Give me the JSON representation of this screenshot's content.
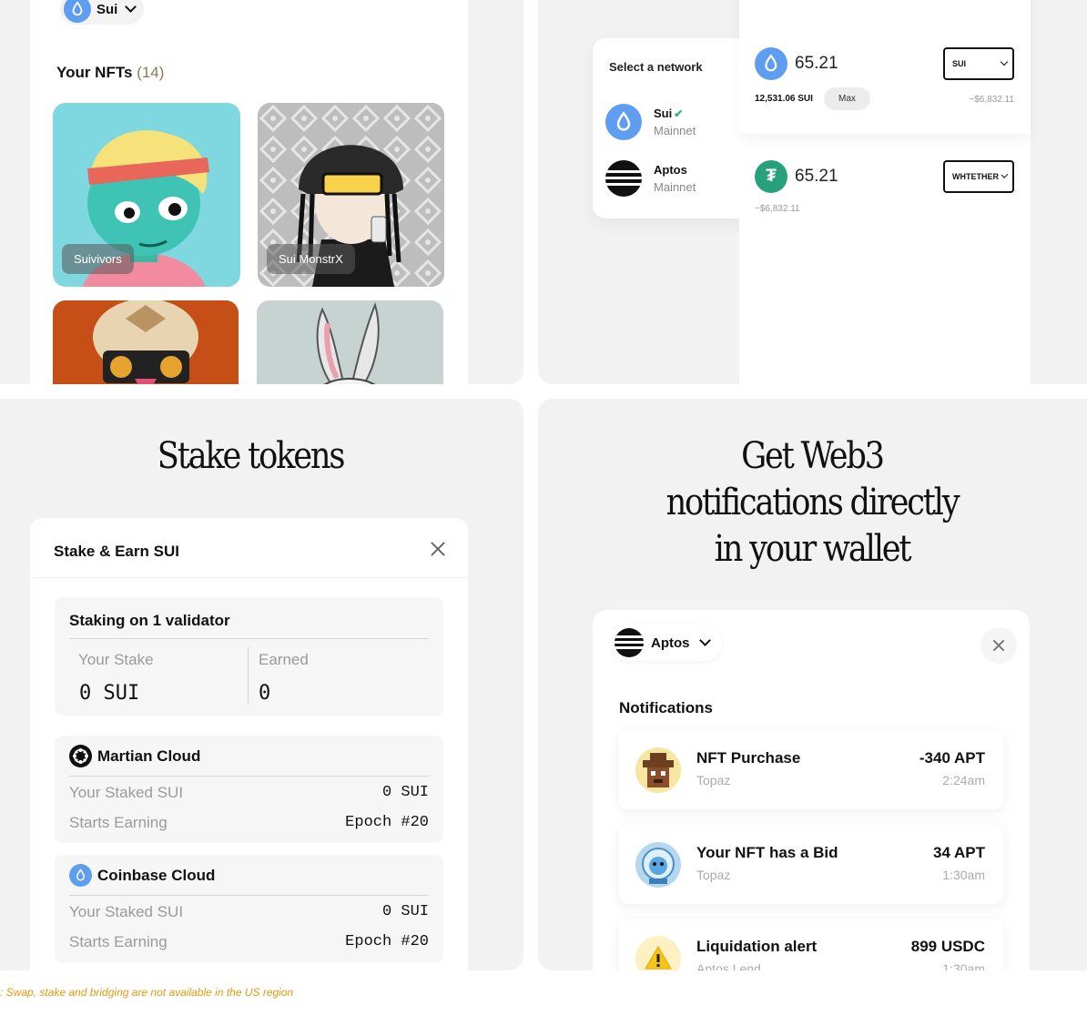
{
  "nfts_panel": {
    "network_label": "Sui",
    "title": "Your NFTs",
    "count": "(14)",
    "items": [
      {
        "label": "Suivivors"
      },
      {
        "label": "Sui MonstrX"
      },
      {
        "label": ""
      },
      {
        "label": ""
      }
    ]
  },
  "network_panel": {
    "popover_title": "Select a network",
    "networks": [
      {
        "name": "Sui",
        "sub": "Mainnet",
        "check": "✔"
      },
      {
        "name": "Aptos",
        "sub": "Mainnet"
      }
    ],
    "swap": {
      "from_amount": "65.21",
      "from_token": "SUI",
      "balance": "12,531.06 SUI",
      "max_label": "Max",
      "from_usd": "~$6,832.11",
      "to_amount": "65.21",
      "to_token": "WHTETHER",
      "to_usd": "~$6,832.11"
    }
  },
  "stake_panel": {
    "heading": "Stake tokens",
    "card_title": "Stake & Earn SUI",
    "summary": {
      "title": "Staking on 1 validator",
      "stake_label": "Your Stake",
      "stake_value": "0 SUI",
      "earned_label": "Earned",
      "earned_value": "0"
    },
    "validators": [
      {
        "name": "Martian Cloud",
        "staked_label": "Your Staked SUI",
        "staked_value": "0 SUI",
        "earning_label": "Starts Earning",
        "earning_value": "Epoch #20"
      },
      {
        "name": "Coinbase Cloud",
        "staked_label": "Your Staked SUI",
        "staked_value": "0 SUI",
        "earning_label": "Starts Earning",
        "earning_value": "Epoch #20"
      }
    ]
  },
  "notif_panel": {
    "heading_line1": "Get Web3",
    "heading_line2": "notifications directly",
    "heading_line3": "in your wallet",
    "network_label": "Aptos",
    "title": "Notifications",
    "items": [
      {
        "title": "NFT Purchase",
        "sub": "Topaz",
        "amount": "-340 APT",
        "time": "2:24am"
      },
      {
        "title": "Your NFT has a Bid",
        "sub": "Topaz",
        "amount": "34 APT",
        "time": "1:30am"
      },
      {
        "title": "Liquidation alert",
        "sub": "Aptos Lend",
        "amount": "899 USDC",
        "time": "1:30am"
      }
    ]
  },
  "footnote": ": Swap, stake and bridging are not available in the US region",
  "colors": {
    "sui_blue": "#5e9df0",
    "tether_green": "#26a17b",
    "footnote_orange": "#e39a12",
    "check_green": "#2bb673"
  }
}
